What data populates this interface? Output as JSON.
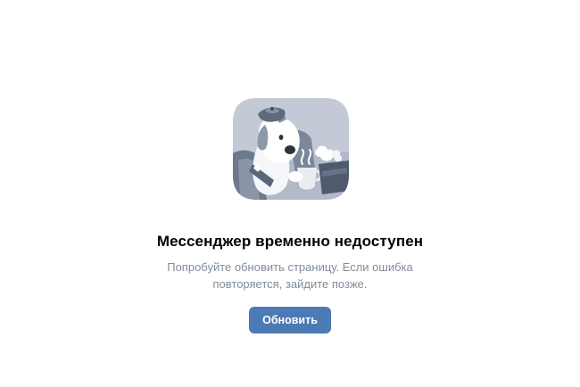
{
  "error": {
    "icon": "sick-dog-mascot-icon",
    "title": "Мессенджер временно недоступен",
    "description_line1": "Попробуйте обновить страницу. Если ошибка",
    "description_line2": "повторяется, зайдите позже.",
    "button_label": "Обновить"
  },
  "colors": {
    "accent": "#4c7ab5",
    "text_secondary": "#818c99",
    "illustration_bg": "#b1b9c8",
    "illustration_dark": "#6e7b8d"
  }
}
